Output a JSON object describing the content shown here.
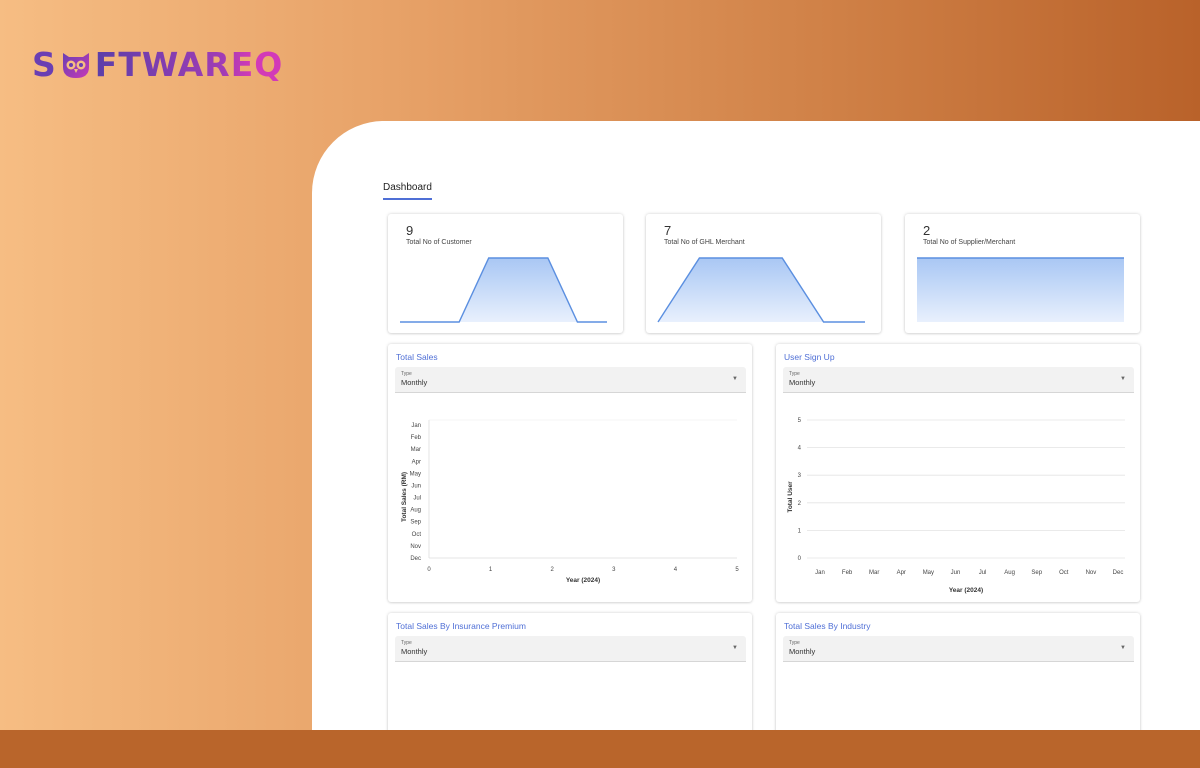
{
  "brand": {
    "logo_text": "SOFTWAREQ",
    "logo_prefix": "S",
    "logo_middle": "FTWARE",
    "logo_suffix": "Q"
  },
  "tabs": [
    {
      "label": "Dashboard",
      "active": true
    }
  ],
  "kpis": [
    {
      "value": "9",
      "label": "Total No of Customer",
      "trend": [
        0,
        0,
        0,
        1,
        1,
        1,
        0,
        0
      ]
    },
    {
      "value": "7",
      "label": "Total No of GHL Merchant",
      "trend": [
        0,
        1,
        1,
        1,
        0,
        0
      ]
    },
    {
      "value": "2",
      "label": "Total No of Supplier/Merchant",
      "trend": [
        1,
        1
      ]
    }
  ],
  "colors": {
    "accent": "#4f6fd6",
    "line": "#5b8fe0",
    "fill": "#cfe0fa"
  },
  "charts": {
    "total_sales": {
      "title": "Total Sales",
      "type_label": "Type",
      "type_value": "Monthly",
      "arrow": "▼"
    },
    "user_signup": {
      "title": "User Sign Up",
      "type_label": "Type",
      "type_value": "Monthly",
      "arrow": "▼"
    },
    "insurance": {
      "title": "Total Sales By Insurance Premium",
      "type_label": "Type",
      "type_value": "Monthly",
      "arrow": "▼"
    },
    "industry": {
      "title": "Total Sales By Industry",
      "type_label": "Type",
      "type_value": "Monthly",
      "arrow": "▼"
    }
  },
  "chart_data": [
    {
      "type": "bar",
      "orientation": "horizontal",
      "title": "Total Sales",
      "categories": [
        "Jan",
        "Feb",
        "Mar",
        "Apr",
        "May",
        "Jun",
        "Jul",
        "Aug",
        "Sep",
        "Oct",
        "Nov",
        "Dec"
      ],
      "values": [
        0,
        0,
        0,
        0,
        0,
        0,
        0,
        0,
        0,
        0,
        0,
        0
      ],
      "xlabel": "Year (2024)",
      "ylabel": "Total Sales (RM)",
      "xlim": [
        0,
        5
      ],
      "xticks": [
        "0",
        "1",
        "2",
        "3",
        "4",
        "5"
      ]
    },
    {
      "type": "line",
      "title": "User Sign Up",
      "categories": [
        "Jan",
        "Feb",
        "Mar",
        "Apr",
        "May",
        "Jun",
        "Jul",
        "Aug",
        "Sep",
        "Oct",
        "Nov",
        "Dec"
      ],
      "values": [
        0,
        0,
        0,
        0,
        0,
        0,
        0,
        0,
        0,
        0,
        0,
        0
      ],
      "xlabel": "Year (2024)",
      "ylabel": "Total User",
      "ylim": [
        0,
        5
      ],
      "yticks": [
        "0",
        "1",
        "2",
        "3",
        "4",
        "5"
      ],
      "grid": true
    }
  ]
}
